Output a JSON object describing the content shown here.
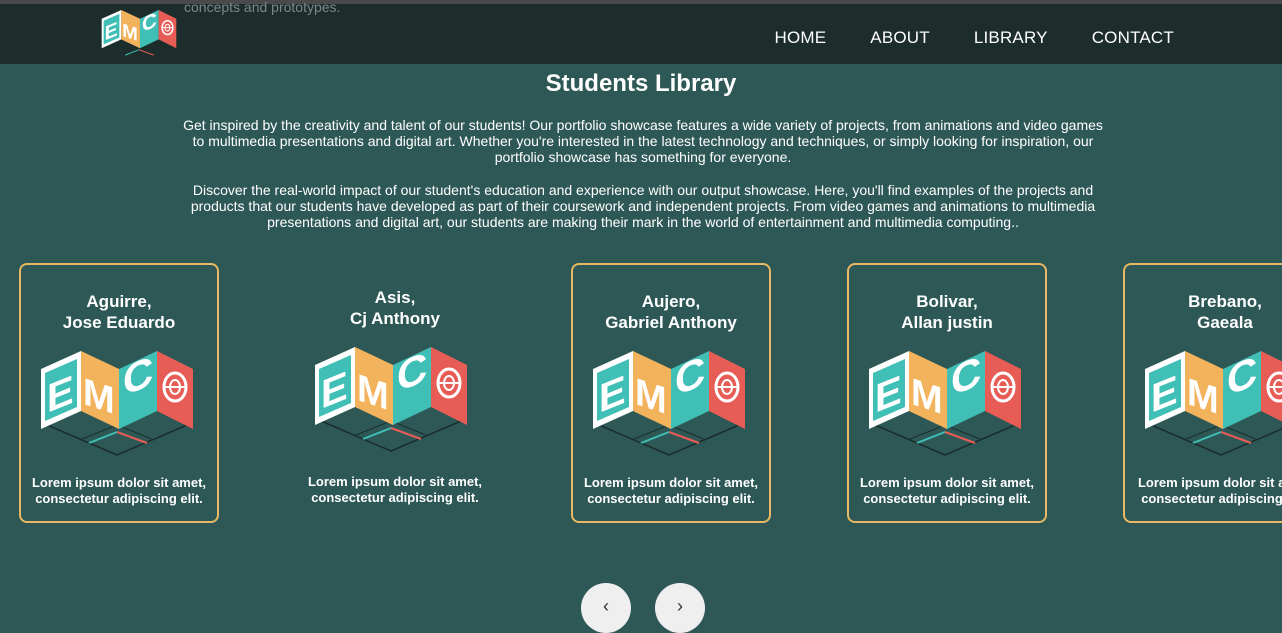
{
  "header": {
    "partial_text": "concepts and prototypes.",
    "nav": [
      "HOME",
      "ABOUT",
      "LIBRARY",
      "CONTACT"
    ]
  },
  "main": {
    "title": "Students Library",
    "intro_1": "Get inspired by the creativity and talent of our students! Our portfolio showcase features a wide variety of projects, from animations and video games to multimedia presentations and digital art. Whether you're interested in the latest technology and techniques, or simply looking for inspiration, our portfolio showcase has something for everyone.",
    "intro_2": "Discover the real-world impact of our student's education and experience with our output showcase. Here, you'll find examples of the projects and products that our students have developed as part of their coursework and independent projects. From video games and animations to multimedia presentations and digital art, our students are making their mark in the world of entertainment and multimedia computing.."
  },
  "cards": [
    {
      "last": "Aguirre,",
      "first": "Jose Eduardo",
      "desc_1": "Lorem ipsum dolor sit amet,",
      "desc_2": "consectetur adipiscing elit."
    },
    {
      "last": "Asis,",
      "first": "Cj Anthony",
      "desc_1": "Lorem ipsum dolor sit amet,",
      "desc_2": "consectetur adipiscing elit."
    },
    {
      "last": "Aujero,",
      "first": "Gabriel Anthony",
      "desc_1": "Lorem ipsum dolor sit amet,",
      "desc_2": "consectetur adipiscing elit."
    },
    {
      "last": "Bolivar,",
      "first": "Allan justin",
      "desc_1": "Lorem ipsum dolor sit amet,",
      "desc_2": "consectetur adipiscing elit."
    },
    {
      "last": "Brebano,",
      "first": "Gaeala",
      "desc_1": "Lorem ipsum dolor sit amet,",
      "desc_2": "consectetur adipiscing elit."
    }
  ],
  "pager": {
    "prev": "‹",
    "next": "›"
  },
  "colors": {
    "background": "#2e5856",
    "navbar": "#1c2d2c",
    "card_border": "#e8b865",
    "logo_yellow": "#f2b35c",
    "logo_teal": "#3fbfb5",
    "logo_red": "#e85c56"
  },
  "icons": {
    "logo": "emc-logo-icon",
    "prev": "chevron-left-icon",
    "next": "chevron-right-icon"
  }
}
